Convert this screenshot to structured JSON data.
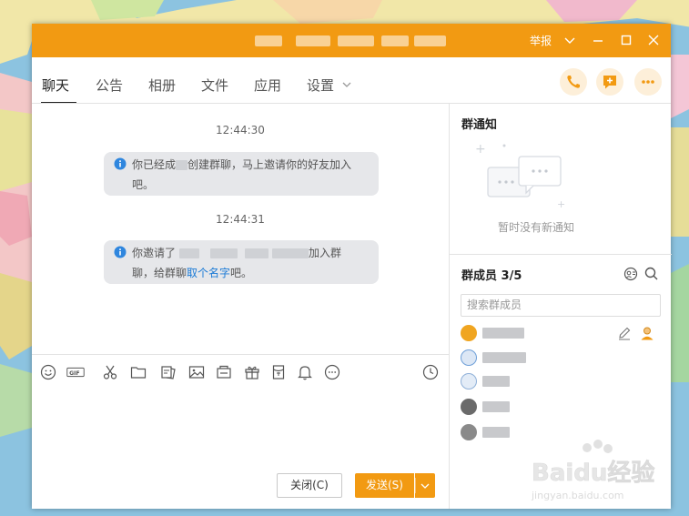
{
  "titlebar": {
    "report_label": "举报",
    "accent_color": "#f29a12"
  },
  "tabs": [
    {
      "label": "聊天",
      "active": true
    },
    {
      "label": "公告"
    },
    {
      "label": "相册"
    },
    {
      "label": "文件"
    },
    {
      "label": "应用"
    },
    {
      "label": "设置"
    }
  ],
  "messages": [
    {
      "time": "12:44:30",
      "line1_a": "你已经成",
      "line1_b": "创建群聊，马上邀请你的好友加入",
      "line2": "吧。"
    },
    {
      "time": "12:44:31",
      "line1_a": "你邀请了",
      "line1_b": "加入群",
      "line2_a": "聊，给群聊",
      "line2_link": "取个名字",
      "line2_b": "吧。"
    }
  ],
  "toolbar_icons": [
    "emoji-icon",
    "gif-icon",
    "scissors-icon",
    "folder-icon",
    "image-text-icon",
    "image-icon",
    "gift-box-icon",
    "gift-icon",
    "red-envelope-icon",
    "bell-icon",
    "more-icon",
    "history-clock-icon"
  ],
  "actions": {
    "close_label": "关闭(C)",
    "send_label": "发送(S)"
  },
  "notice": {
    "title": "群通知",
    "empty_text": "暂时没有新通知"
  },
  "members": {
    "title": "群成员 3/5",
    "search_placeholder": "搜索群成员",
    "avatar_colors": [
      "#f0a520",
      "#6e9fd8",
      "#8fb0d8",
      "#6a6a6a",
      "#8a8a8a"
    ]
  },
  "watermark": {
    "brand": "Baidu经验",
    "url": "jingyan.baidu.com"
  }
}
